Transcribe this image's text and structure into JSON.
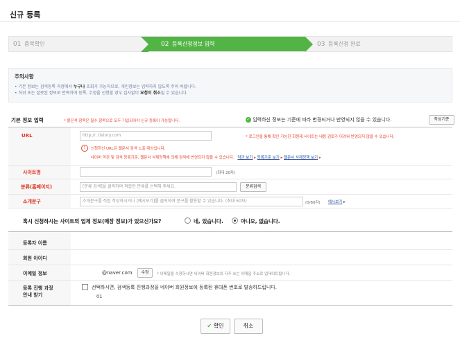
{
  "page": {
    "title": "신규 등록"
  },
  "steps": [
    {
      "num": "01",
      "label": "중복확인"
    },
    {
      "num": "02",
      "label": "등록신청정보 입력"
    },
    {
      "num": "03",
      "label": "등록신청 완료"
    }
  ],
  "notice": {
    "title": "주의사항",
    "line1_pre": "• 기본 정보는 검색등록 과정에서 ",
    "line1_bold": "누구나",
    "line1_post": " 조회가 가능하므로, 개인정보는 입력하지 않도록 주의 바랍니다.",
    "line2_pre": "• 허위 또는 잘못된 정보로 반복하여 등록, 수정을 신청할 경우 심사없이 ",
    "line2_bold": "요청이 취소",
    "line2_post": "될 수 있습니다."
  },
  "basic": {
    "section_title": "기본 정보 입력",
    "required_note": "* 붉은색 항목은 필수 항목으로 모두 기입되어야 신규 등록이 가능합니다.",
    "info_note": "입력하신 정보는 기준에 따라 변경되거나 반영되지 않을 수 있습니다.",
    "criteria_button": "작성기준"
  },
  "url": {
    "label": "URL",
    "value": "http://         .tistory.com",
    "login_note": "* 로그인을 통해 확인 가능한 회원제 사이트는 내용 검토가 어려워 반영되지 않을 수 있습니다.",
    "warn1": "신청하신 URL은 웹문서 검색 노출 대상입니다.",
    "warn2": "네이버 약관 및 검색 등록기준, 웹문서 삭제정책에 의해 검색에 반영되지 않을 수 있습니다.",
    "link1": "약관 보기",
    "link2": "등록기준 보기",
    "link3": "웹문서 삭제정책 보기"
  },
  "site_name": {
    "label": "사이트명",
    "hint": "(최대 20자)"
  },
  "category": {
    "label": "분류(홈페이지)",
    "placeholder": "[분류 검색]을 클릭하여 적합한 분류를 선택해 주세요.",
    "button": "분류검색"
  },
  "intro": {
    "label": "소개문구",
    "placeholder": "소개문구를 직접 작성하시거나 [예시보기]를 클릭하여 문구를 활용할 수 있습니다. (최대 60자)",
    "counter": "(0/60자)",
    "example_link": "예시보기"
  },
  "question": {
    "text": "혹시 신청하시는 사이트의 업체 정보(매장 정보)가 있으신가요?",
    "yes": "네, 있습니다.",
    "no": "아니오, 없습니다."
  },
  "registrant": {
    "name_label": "등록자 이름",
    "id_label": "회원 아이디",
    "email_label": "이메일 정보",
    "email_value": "@naver.com",
    "email_button": "수정",
    "email_note": "* 이메일을 수정하시면 네이버 회원정보의 자주 쓰는 이메일 주소로 업데이트됩니다.",
    "progress_label1": "등록 진행 과정",
    "progress_label2": "안내 받기",
    "progress_text": "선택하시면, 검색등록 진행과정을 네이버 회원정보에 등록된 휴대폰 번호로 발송하드립니다.",
    "phone_value": "01"
  },
  "actions": {
    "confirm": "확인",
    "cancel": "취소"
  },
  "colors": {
    "accent": "#53b446",
    "required": "#e5432e",
    "link": "#2a4e9a"
  }
}
